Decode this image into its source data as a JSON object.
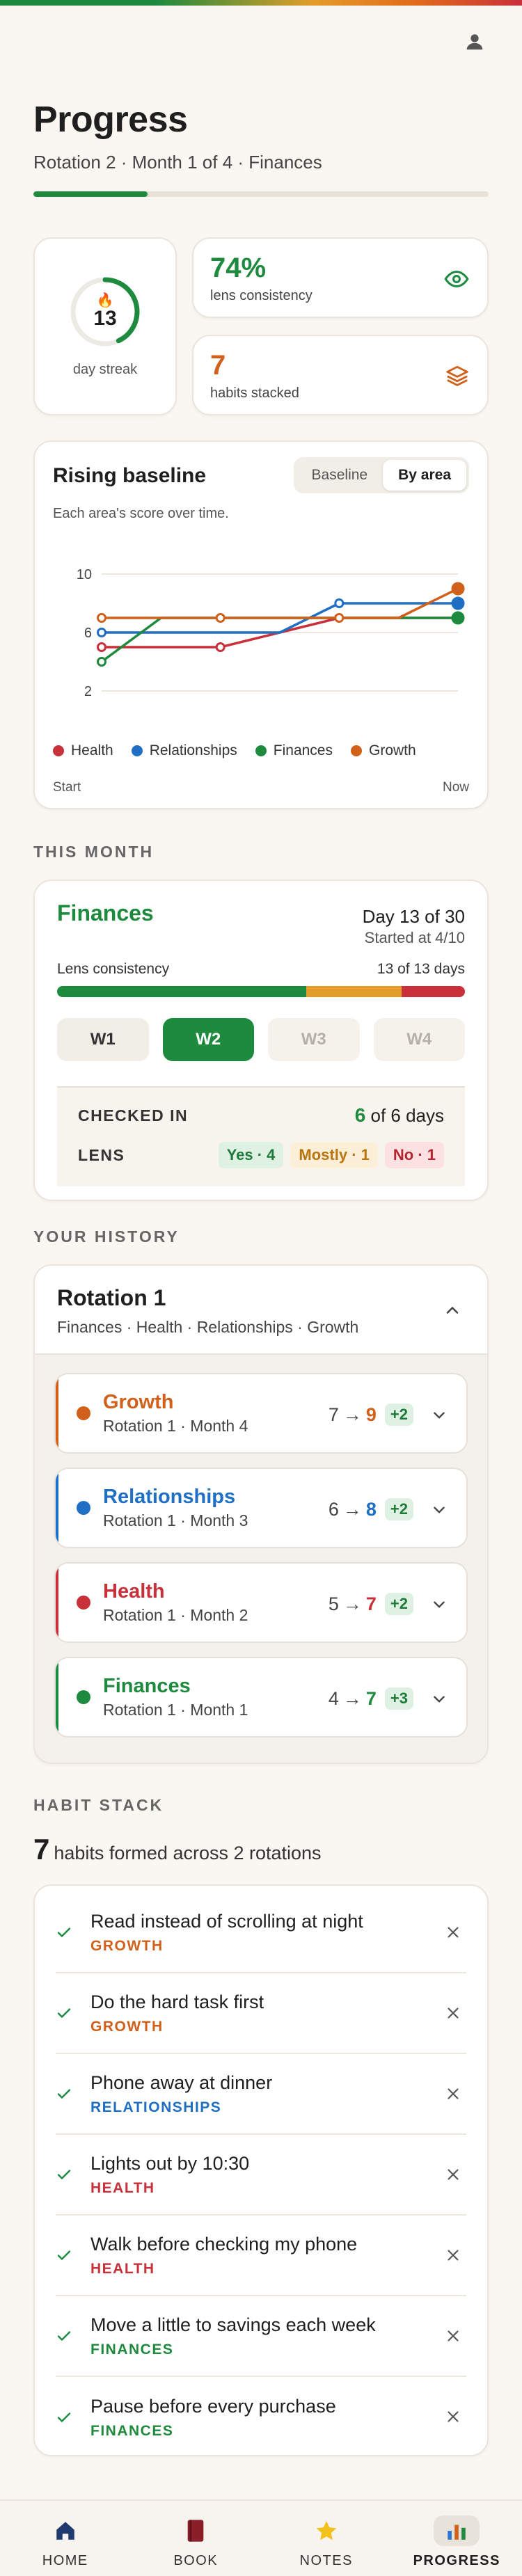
{
  "colors": {
    "health": "#c8303a",
    "relationships": "#1f6fc4",
    "finances": "#1e8a3e",
    "growth": "#d0601a",
    "mostly": "#e39d2a"
  },
  "header": {
    "title": "Progress",
    "subtitle": "Rotation 2 · Month 1 of 4 · Finances",
    "progress": 0.25,
    "avatar_icon": "person-icon"
  },
  "stats": {
    "streak_value": "13",
    "streak_label": "day streak",
    "streak_fraction": 0.43,
    "consistency_value": "74%",
    "consistency_label": "lens consistency",
    "stacked_value": "7",
    "stacked_label": "habits stacked"
  },
  "baseline": {
    "title": "Rising baseline",
    "tabs": [
      "Baseline",
      "By area"
    ],
    "active_tab": 1,
    "description": "Each area's score over time.",
    "start_label": "Start",
    "end_label": "Now"
  },
  "chart_data": {
    "type": "line",
    "x": [
      0,
      1,
      2,
      3,
      4,
      5,
      6
    ],
    "ylim": [
      2,
      10
    ],
    "yticks": [
      2,
      6,
      10
    ],
    "legend_position": "bottom",
    "grid": true,
    "series": [
      {
        "name": "Health",
        "color": "#c8303a",
        "values": [
          5,
          5,
          5,
          6,
          7,
          7,
          7
        ],
        "markers": [
          0,
          2
        ]
      },
      {
        "name": "Relationships",
        "color": "#1f6fc4",
        "values": [
          6,
          6,
          6,
          6,
          8,
          8,
          8
        ],
        "markers": [
          0,
          4,
          6
        ]
      },
      {
        "name": "Finances",
        "color": "#1e8a3e",
        "values": [
          4,
          7,
          7,
          7,
          7,
          7,
          7
        ],
        "markers": [
          0,
          6
        ]
      },
      {
        "name": "Growth",
        "color": "#d0601a",
        "values": [
          7,
          7,
          7,
          7,
          7,
          7,
          9
        ],
        "markers": [
          0,
          2,
          4,
          6
        ]
      }
    ]
  },
  "this_month": {
    "section_label": "THIS MONTH",
    "area": "Finances",
    "day_of": "Day 13 of 30",
    "started": "Started at 4/10",
    "lens_label": "Lens consistency",
    "lens_days": "13 of 13 days",
    "lens_split": {
      "yes": 0.55,
      "mostly": 0.21,
      "no": 0.14
    },
    "weeks": [
      "W1",
      "W2",
      "W3",
      "W4"
    ],
    "active_week": 1,
    "checked_in_label": "CHECKED IN",
    "checked_in_count": "6",
    "checked_in_rest": " of 6 days",
    "lens_row_label": "LENS",
    "lens_yes": "Yes · 4",
    "lens_mostly": "Mostly · 1",
    "lens_no": "No · 1"
  },
  "history": {
    "section_label": "YOUR HISTORY",
    "rotation_title": "Rotation 1",
    "rotation_areas": "Finances · Health · Relationships · Growth",
    "items": [
      {
        "name": "Growth",
        "sub": "Rotation 1 · Month 4",
        "from": "7",
        "to": "9",
        "delta": "+2",
        "color": "#d0601a"
      },
      {
        "name": "Relationships",
        "sub": "Rotation 1 · Month 3",
        "from": "6",
        "to": "8",
        "delta": "+2",
        "color": "#1f6fc4"
      },
      {
        "name": "Health",
        "sub": "Rotation 1 · Month 2",
        "from": "5",
        "to": "7",
        "delta": "+2",
        "color": "#c8303a"
      },
      {
        "name": "Finances",
        "sub": "Rotation 1 · Month 1",
        "from": "4",
        "to": "7",
        "delta": "+3",
        "color": "#1e8a3e"
      }
    ]
  },
  "habit_stack": {
    "section_label": "HABIT STACK",
    "count": "7",
    "count_text": "habits formed across 2 rotations",
    "habits": [
      {
        "name": "Read instead of scrolling at night",
        "area": "GROWTH",
        "color": "#d0601a"
      },
      {
        "name": "Do the hard task first",
        "area": "GROWTH",
        "color": "#d0601a"
      },
      {
        "name": "Phone away at dinner",
        "area": "RELATIONSHIPS",
        "color": "#1f6fc4"
      },
      {
        "name": "Lights out by 10:30",
        "area": "HEALTH",
        "color": "#c8303a"
      },
      {
        "name": "Walk before checking my phone",
        "area": "HEALTH",
        "color": "#c8303a"
      },
      {
        "name": "Move a little to savings each week",
        "area": "FINANCES",
        "color": "#1e8a3e"
      },
      {
        "name": "Pause before every purchase",
        "area": "FINANCES",
        "color": "#1e8a3e"
      }
    ]
  },
  "nav": {
    "items": [
      {
        "label": "HOME",
        "icon": "home-icon"
      },
      {
        "label": "BOOK",
        "icon": "book-icon"
      },
      {
        "label": "NOTES",
        "icon": "star-icon"
      },
      {
        "label": "PROGRESS",
        "icon": "bar-chart-icon"
      }
    ],
    "active": 3
  }
}
